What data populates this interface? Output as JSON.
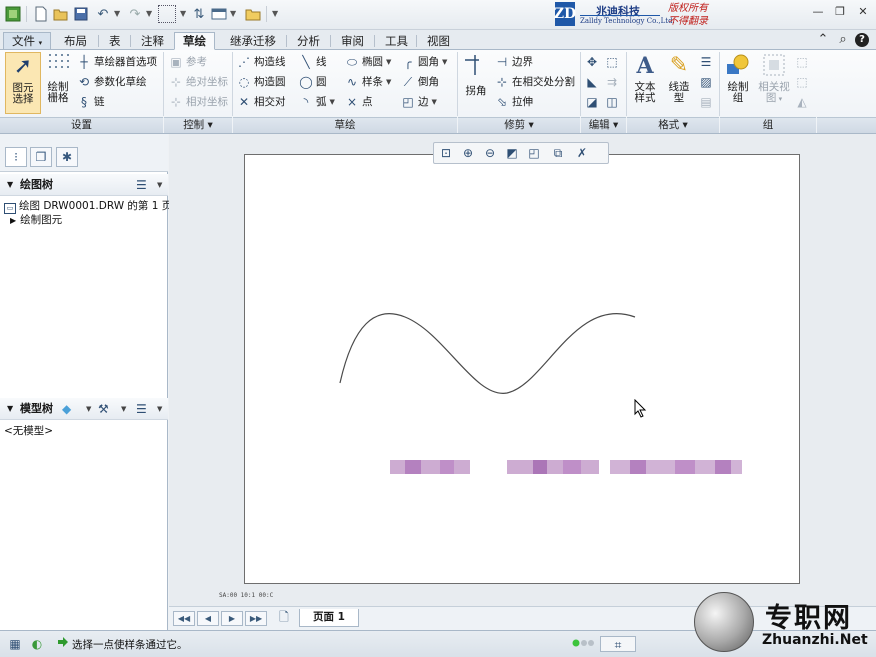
{
  "quick_access": {
    "icons": [
      "app-icon",
      "new-icon",
      "open-icon",
      "save-icon",
      "undo-icon",
      "redo-icon",
      "select-box-icon",
      "regenerate-icon",
      "window-icon",
      "folder-icon",
      "customize-icon"
    ]
  },
  "brand": {
    "logo_text": "ZD",
    "name_cn": "兆迪科技",
    "name_en": "Zalldy Technology Co.,Ltd.",
    "rights_line1": "版权所有",
    "rights_line2": "不得翻录"
  },
  "tabs": [
    {
      "label": "文件",
      "dropdown": true
    },
    {
      "label": "布局"
    },
    {
      "label": "表"
    },
    {
      "label": "注释"
    },
    {
      "label": "草绘",
      "active": true
    },
    {
      "label": "继承迁移"
    },
    {
      "label": "分析"
    },
    {
      "label": "审阅"
    },
    {
      "label": "工具"
    },
    {
      "label": "视图"
    }
  ],
  "ribbon": {
    "groups": [
      {
        "label": "设置"
      },
      {
        "label": "控制 ▾"
      },
      {
        "label": "草绘"
      },
      {
        "label": "修剪 ▾"
      },
      {
        "label": "编辑 ▾"
      },
      {
        "label": "格式 ▾"
      },
      {
        "label": "组"
      }
    ],
    "setup": {
      "select_label_1": "图元",
      "select_label_2": "选择",
      "grid_label_1": "绘制",
      "grid_label_2": "栅格",
      "sketch_pref": "草绘器首选项",
      "param_sketch": "参数化草绘",
      "chain": "链"
    },
    "control": {
      "reference": "参考",
      "absolute": "绝对坐标",
      "relative": "相对坐标"
    },
    "sketch": {
      "construct_line": "构造线",
      "construct_circle": "构造圆",
      "intersect": "相交对",
      "line": "线",
      "circle": "圆",
      "arc": "弧",
      "ellipse": "椭圆",
      "spline": "样条",
      "point": "点",
      "fillet": "圆角",
      "chamfer": "倒角",
      "edge": "边"
    },
    "trim": {
      "corner": "拐角",
      "boundary": "边界",
      "split": "在相交处分割",
      "stretch": "拉伸"
    },
    "format": {
      "text_style_1": "文本",
      "text_style_2": "样式",
      "line_style_1": "线造",
      "line_style_2": "型"
    },
    "group": {
      "draw_group_1": "绘制",
      "draw_group_2": "组",
      "related_view_1": "相关视",
      "related_view_2": "图"
    }
  },
  "left_panel": {
    "drawing_tree": {
      "title": "绘图树",
      "rows": [
        "绘图 DRW0001.DRW 的第 1 页",
        "绘制图元"
      ]
    },
    "model_tree": {
      "title": "模型树",
      "empty": "<无模型>"
    }
  },
  "canvas": {
    "coord_text": "SA:00  10:1  00:C",
    "curve_color": "#4a4a4a",
    "blurred_text_color": "#b07ab8"
  },
  "page_bar": {
    "page_tab": "页面 1"
  },
  "status": {
    "message": "选择一点使样条通过它。"
  },
  "watermark": {
    "cn": "专职网",
    "en": "Zhuanzhi.Net"
  }
}
